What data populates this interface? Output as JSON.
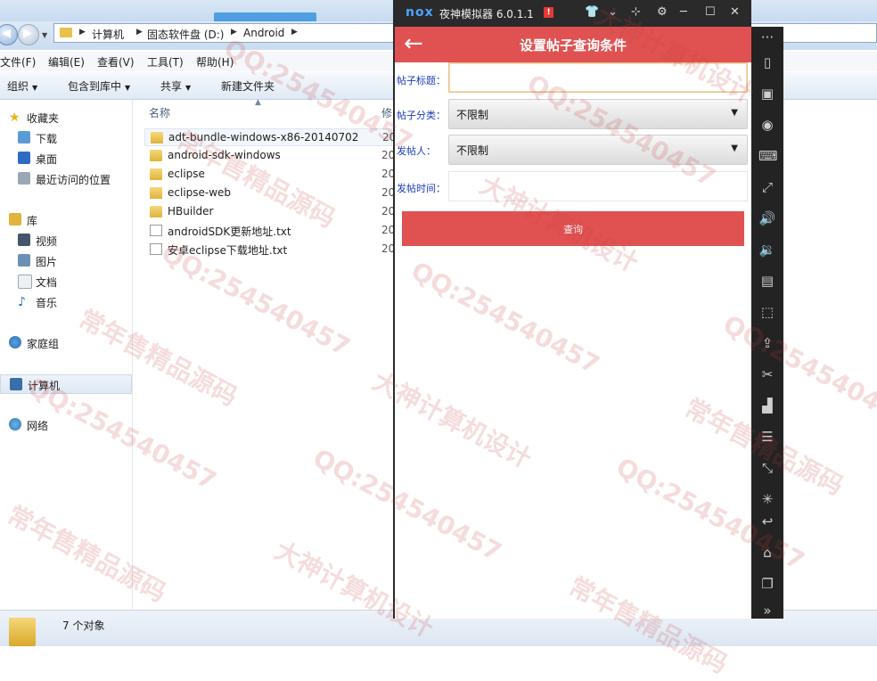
{
  "explorer": {
    "breadcrumbs": [
      "计算机",
      "固态软件盘 (D:)",
      "Android"
    ],
    "menu": [
      "文件(F)",
      "编辑(E)",
      "查看(V)",
      "工具(T)",
      "帮助(H)"
    ],
    "toolbar": {
      "organize": "组织",
      "include": "包含到库中",
      "share": "共享",
      "new_folder": "新建文件夹"
    },
    "nav": {
      "favorites": "收藏夹",
      "downloads": "下载",
      "desktop": "桌面",
      "recent": "最近访问的位置",
      "libraries": "库",
      "videos": "视频",
      "pictures": "图片",
      "documents": "文档",
      "music": "音乐",
      "homegroup": "家庭组",
      "computer": "计算机",
      "network": "网络"
    },
    "columns": {
      "name": "名称",
      "modified": "修"
    },
    "files": [
      {
        "name": "adt-bundle-windows-x86-20140702",
        "type": "folder",
        "date": "20"
      },
      {
        "name": "android-sdk-windows",
        "type": "folder",
        "date": "20"
      },
      {
        "name": "eclipse",
        "type": "folder",
        "date": "20"
      },
      {
        "name": "eclipse-web",
        "type": "folder",
        "date": "20"
      },
      {
        "name": "HBuilder",
        "type": "folder",
        "date": "20"
      },
      {
        "name": "androidSDK更新地址.txt",
        "type": "txt",
        "date": "20"
      },
      {
        "name": "安卓eclipse下载地址.txt",
        "type": "txt",
        "date": "20"
      }
    ],
    "status": "7 个对象"
  },
  "nox": {
    "logo": "nox",
    "title": "夜神模拟器 6.0.1.1",
    "badge": "!"
  },
  "app": {
    "title": "设置帖子查询条件",
    "fields": {
      "title_label": "帖子标题：",
      "title_value": "",
      "category_label": "帖子分类：",
      "category_value": "不限制",
      "poster_label": "发帖人：",
      "poster_value": "不限制",
      "time_label": "发帖时间：",
      "time_value": ""
    },
    "query_button": "查询"
  },
  "watermark": {
    "qq": "QQ:254540457",
    "shop": "常年售精品源码",
    "design": "大神计算机设计"
  },
  "colors": {
    "accent": "#e05252",
    "label_blue": "#1a3cc0",
    "nox_dark": "#2a2a2a"
  }
}
